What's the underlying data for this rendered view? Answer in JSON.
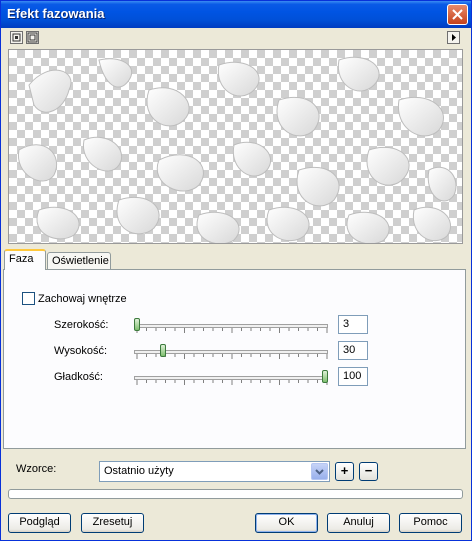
{
  "window": {
    "title": "Efekt fazowania"
  },
  "toolbar": {
    "icons": [
      "zoom-fit-icon",
      "actual-size-icon",
      "expand-arrow-icon"
    ]
  },
  "tabs": [
    {
      "label": "Faza",
      "active": true
    },
    {
      "label": "Oświetlenie",
      "active": false
    }
  ],
  "faza": {
    "keep_inner_label": "Zachowaj wnętrze",
    "keep_inner_checked": false,
    "sliders": [
      {
        "label": "Szerokość:",
        "value": "3",
        "fraction": 0.0
      },
      {
        "label": "Wysokość:",
        "value": "30",
        "fraction": 0.14
      },
      {
        "label": "Gładkość:",
        "value": "100",
        "fraction": 1.0
      }
    ]
  },
  "presets": {
    "label": "Wzorce:",
    "selected": "Ostatnio użyty",
    "add_label": "+",
    "remove_label": "−"
  },
  "progress": {
    "fraction": 0
  },
  "buttons": {
    "preview": "Podgląd",
    "reset": "Zresetuj",
    "ok": "OK",
    "cancel": "Anuluj",
    "help": "Pomoc"
  },
  "colors": {
    "titlebar": "#0054e3",
    "dialog_bg": "#ece9d8",
    "tab_highlight": "#ffc83c",
    "slider_thumb": "#7fbf6f"
  }
}
